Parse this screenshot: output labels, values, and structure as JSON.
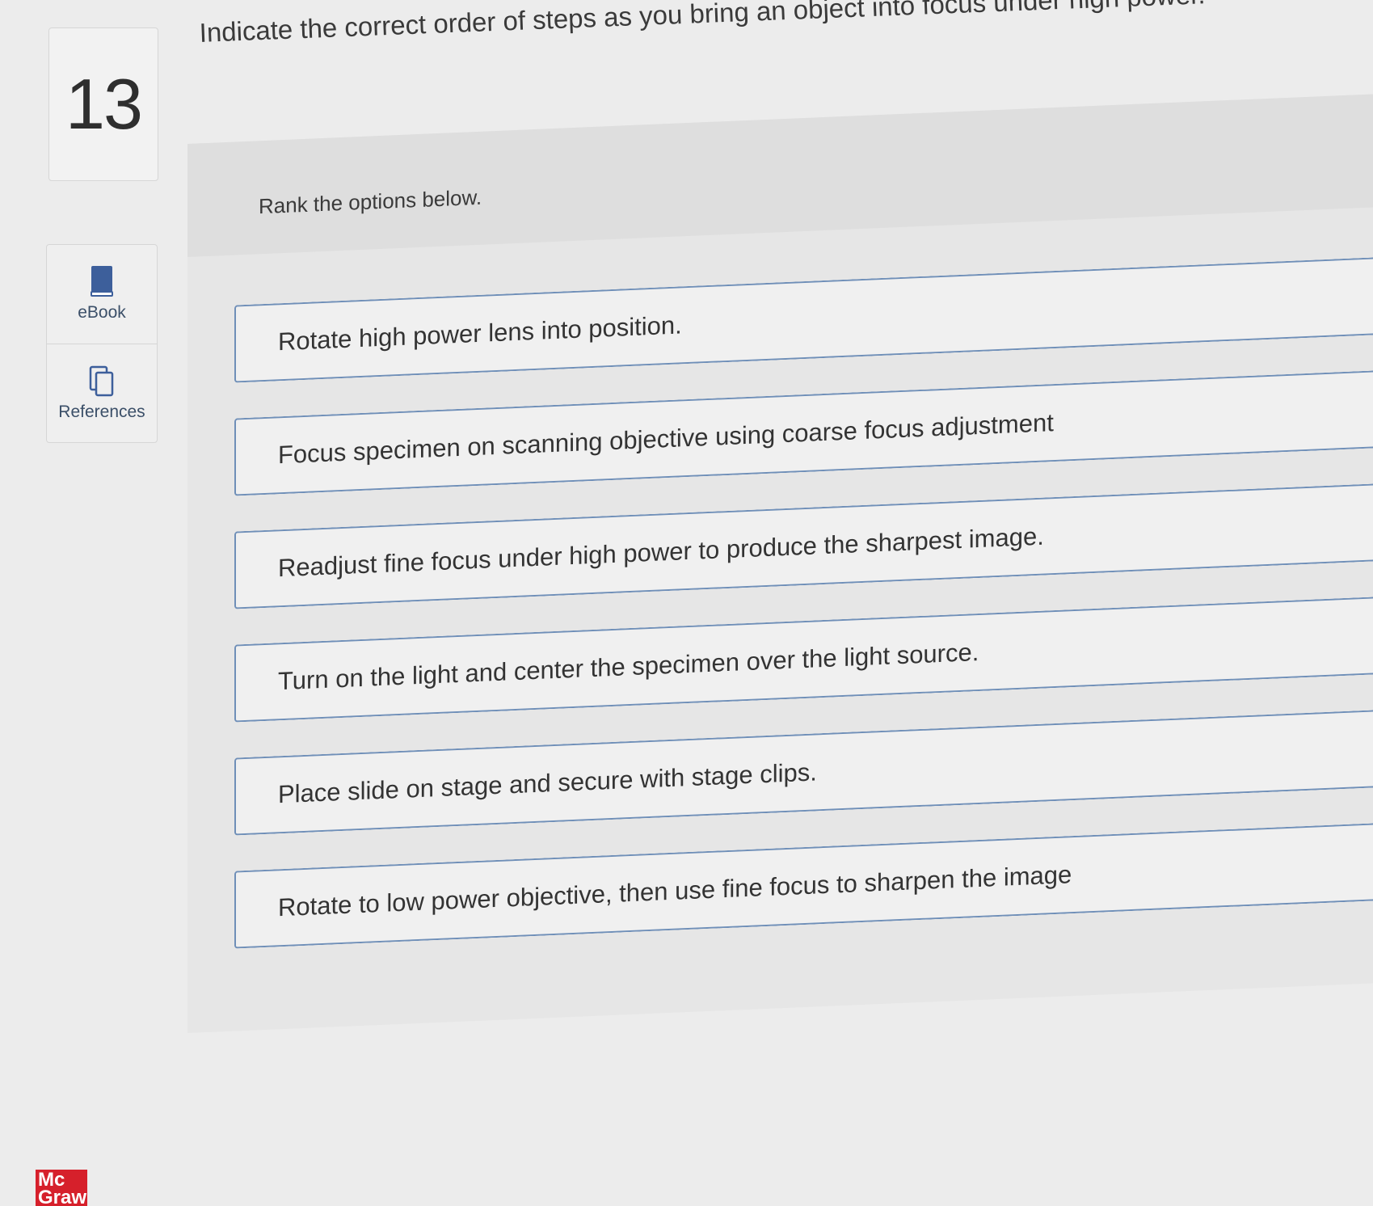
{
  "question": {
    "number": "13",
    "text": "Indicate the correct order of steps as you bring an object into focus under high power."
  },
  "tools": [
    {
      "label": "eBook",
      "icon": "ebook-icon"
    },
    {
      "label": "References",
      "icon": "references-icon"
    }
  ],
  "ranking": {
    "instruction": "Rank the options below.",
    "options": [
      "Rotate high power lens into position.",
      "Focus specimen on scanning objective using coarse focus adjustment",
      "Readjust fine focus under high power to produce the sharpest image.",
      "Turn on the light and center the specimen over the light source.",
      "Place slide on stage and secure with stage clips.",
      "Rotate to low power objective, then use fine focus to sharpen the image"
    ]
  },
  "logo": {
    "line1": "Mc",
    "line2": "Graw"
  },
  "colors": {
    "option_border": "#6f8fb8",
    "tool_icon": "#3d5f9b",
    "logo_bg": "#d6202b"
  }
}
